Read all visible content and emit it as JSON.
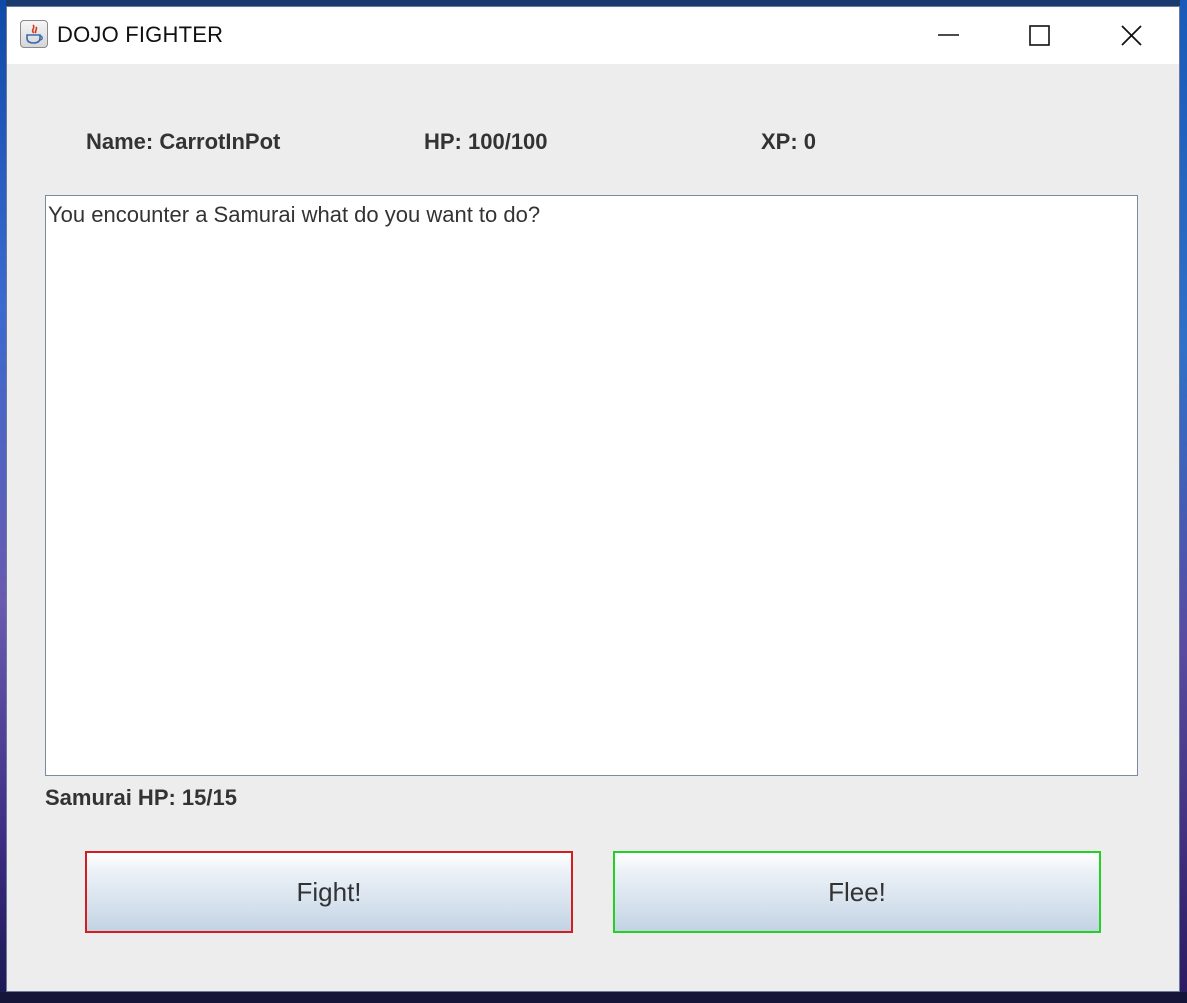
{
  "window": {
    "title": "DOJO FIGHTER"
  },
  "player": {
    "name_label": "Name: CarrotInPot",
    "hp_label": "HP: 100/100",
    "xp_label": "XP: 0"
  },
  "log": {
    "text": "You encounter a Samurai what do you want to do?"
  },
  "enemy": {
    "hp_label": "Samurai HP: 15/15"
  },
  "actions": {
    "fight_label": "Fight!",
    "flee_label": "Flee!"
  },
  "colors": {
    "fight_border": "#d21e1e",
    "flee_border": "#25d025"
  }
}
